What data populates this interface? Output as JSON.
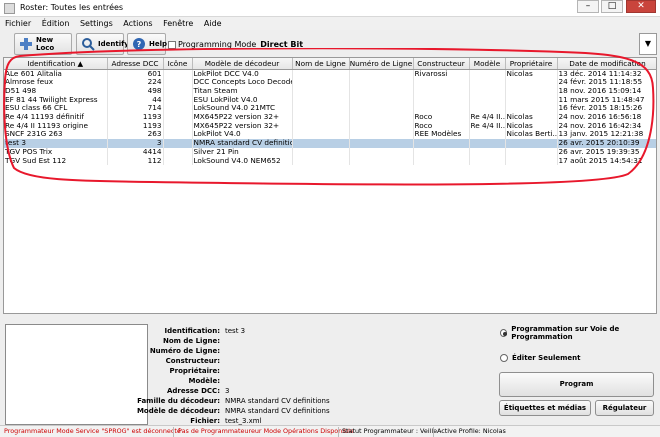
{
  "window": {
    "title": "Roster: Toutes les entrées",
    "minimize": "–",
    "maximize": "□",
    "close": "✕"
  },
  "menu": [
    "Fichier",
    "Édition",
    "Settings",
    "Actions",
    "Fenêtre",
    "Aide"
  ],
  "toolbar": {
    "new_loco": "New Loco",
    "identify": "Identify",
    "help": "Help",
    "programming_mode_label": "Programming Mode",
    "programming_mode_value": "Direct Bit",
    "dropdown_arrow": "▼"
  },
  "table": {
    "headers": [
      "Identification ▲",
      "Adresse DCC",
      "Icône",
      "Modèle de décodeur",
      "Nom de Ligne",
      "Numéro de Ligne",
      "Constructeur",
      "Modèle",
      "Propriétaire",
      "Date de modification"
    ],
    "rows": [
      [
        "ALe 601 Alitalia",
        "601",
        "",
        "LokPilot DCC V4.0",
        "",
        "",
        "Rivarossi",
        "",
        "Nicolas",
        "13 déc. 2014 11:14:32"
      ],
      [
        "Almrose feux",
        "224",
        "",
        "DCC Concepts Loco Decoders",
        "",
        "",
        "",
        "",
        "",
        "24 févr. 2015 11:18:55"
      ],
      [
        "D51 498",
        "498",
        "",
        "Titan Steam",
        "",
        "",
        "",
        "",
        "",
        "18 nov. 2016 15:09:14"
      ],
      [
        "EF 81 44 Twilight Express",
        "44",
        "",
        "ESU LokPilot V4.0",
        "",
        "",
        "",
        "",
        "",
        "11 mars 2015 11:48:47"
      ],
      [
        "ESU class 66 CFL",
        "714",
        "",
        "LokSound V4.0 21MTC",
        "",
        "",
        "",
        "",
        "",
        "16 févr. 2015 18:15:26"
      ],
      [
        "Re 4/4 11193 définitif",
        "1193",
        "",
        "MX645P22 version 32+",
        "",
        "",
        "Roco",
        "Re 4/4 II...",
        "Nicolas",
        "24 nov. 2016 16:56:18"
      ],
      [
        "Re 4/4 II 11193 origine",
        "1193",
        "",
        "MX645P22 version 32+",
        "",
        "",
        "Roco",
        "Re 4/4 II...",
        "Nicolas",
        "24 nov. 2016 16:42:34"
      ],
      [
        "SNCF 231G 263",
        "263",
        "",
        "LokPilot V4.0",
        "",
        "",
        "REE Modèles",
        "",
        "Nicolas Berti...",
        "13 janv. 2015 12:21:38"
      ],
      [
        "test 3",
        "3",
        "",
        "NMRA standard CV definitions",
        "",
        "",
        "",
        "",
        "",
        "26 avr. 2015 20:10:39"
      ],
      [
        "TGV POS Trix",
        "4414",
        "",
        "Silver 21 Pin",
        "",
        "",
        "",
        "",
        "",
        "26 avr. 2015 19:39:35"
      ],
      [
        "TGV Sud Est 112",
        "112",
        "",
        "LokSound V4.0 NEM652",
        "",
        "",
        "",
        "",
        "",
        "17 août 2015 14:54:31"
      ]
    ],
    "selected_row_index": 8
  },
  "details": {
    "labels": [
      "Identification:",
      "Nom de Ligne:",
      "Numéro de Ligne:",
      "Constructeur:",
      "Propriétaire:",
      "Modèle:",
      "Adresse DCC:",
      "Famille du décodeur:",
      "Modèle de décodeur:",
      "Fichier:"
    ],
    "values": [
      "test 3",
      "",
      "",
      "",
      "",
      "",
      "3",
      "NMRA standard CV definitions",
      "NMRA standard CV definitions",
      "test_3.xml"
    ]
  },
  "right_panel": {
    "radio_prog_track": "Programmation sur Voie de Programmation",
    "radio_edit_only": "Éditer Seulement",
    "radio_prog_track_selected": true,
    "program_button": "Program",
    "labels_media_button": "Étiquettes et médias",
    "throttle_button": "Régulateur"
  },
  "status": {
    "service_mode": "Programmateur Mode  Service \"SPROG\" est déconnecté",
    "ops_mode": "Pas de Programmateureur Mode Opérations Disponible",
    "programmer_state": "Statut Programmateur :  Veille",
    "active_profile": "Active Profile: Nicolas"
  },
  "colors": {
    "selection": "#b8cfe5",
    "annotation_oval": "#e8182c",
    "status_error": "#cc0000"
  }
}
